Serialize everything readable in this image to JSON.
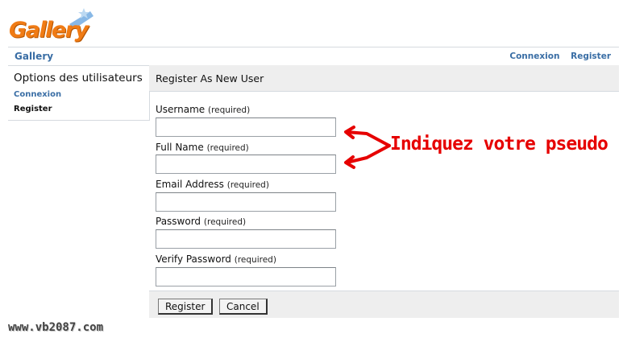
{
  "logo": {
    "text": "Gallery"
  },
  "header": {
    "breadcrumb": "Gallery",
    "links": [
      "Connexion",
      "Register"
    ]
  },
  "sidebar": {
    "title": "Options des utilisateurs",
    "items": [
      {
        "label": "Connexion"
      },
      {
        "label": "Register"
      }
    ]
  },
  "main": {
    "title": "Register As New User",
    "fields": [
      {
        "label": "Username",
        "note": "(required)",
        "value": ""
      },
      {
        "label": "Full Name",
        "note": "(required)",
        "value": ""
      },
      {
        "label": "Email Address",
        "note": "(required)",
        "value": ""
      },
      {
        "label": "Password",
        "note": "(required)",
        "value": ""
      },
      {
        "label": "Verify Password",
        "note": "(required)",
        "value": ""
      }
    ],
    "buttons": {
      "register": "Register",
      "cancel": "Cancel"
    }
  },
  "annotation": {
    "text": "Indiquez votre pseudo",
    "color": "#e60000"
  },
  "watermark": {
    "text": "www.vb2087.com"
  },
  "colors": {
    "link": "#3a6ea5",
    "logo": "#f07b14",
    "panel": "#eeeeee"
  }
}
